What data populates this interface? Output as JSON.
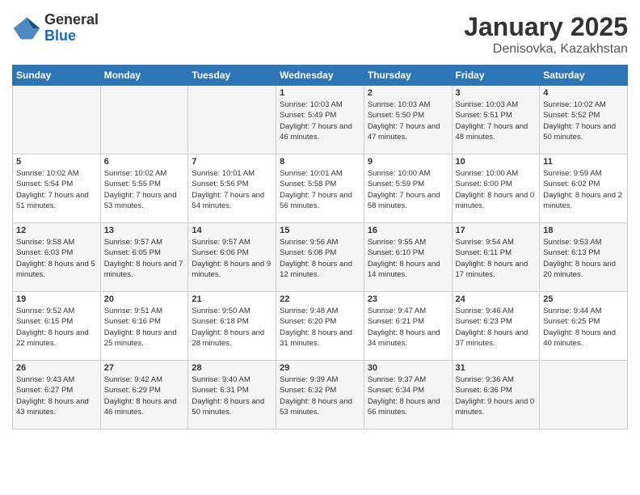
{
  "header": {
    "logo_general": "General",
    "logo_blue": "Blue",
    "title": "January 2025",
    "subtitle": "Denisovka, Kazakhstan"
  },
  "weekdays": [
    "Sunday",
    "Monday",
    "Tuesday",
    "Wednesday",
    "Thursday",
    "Friday",
    "Saturday"
  ],
  "weeks": [
    [
      {
        "day": "",
        "info": ""
      },
      {
        "day": "",
        "info": ""
      },
      {
        "day": "",
        "info": ""
      },
      {
        "day": "1",
        "info": "Sunrise: 10:03 AM\nSunset: 5:49 PM\nDaylight: 7 hours and 46 minutes."
      },
      {
        "day": "2",
        "info": "Sunrise: 10:03 AM\nSunset: 5:50 PM\nDaylight: 7 hours and 47 minutes."
      },
      {
        "day": "3",
        "info": "Sunrise: 10:03 AM\nSunset: 5:51 PM\nDaylight: 7 hours and 48 minutes."
      },
      {
        "day": "4",
        "info": "Sunrise: 10:02 AM\nSunset: 5:52 PM\nDaylight: 7 hours and 50 minutes."
      }
    ],
    [
      {
        "day": "5",
        "info": "Sunrise: 10:02 AM\nSunset: 5:54 PM\nDaylight: 7 hours and 51 minutes."
      },
      {
        "day": "6",
        "info": "Sunrise: 10:02 AM\nSunset: 5:55 PM\nDaylight: 7 hours and 53 minutes."
      },
      {
        "day": "7",
        "info": "Sunrise: 10:01 AM\nSunset: 5:56 PM\nDaylight: 7 hours and 54 minutes."
      },
      {
        "day": "8",
        "info": "Sunrise: 10:01 AM\nSunset: 5:58 PM\nDaylight: 7 hours and 56 minutes."
      },
      {
        "day": "9",
        "info": "Sunrise: 10:00 AM\nSunset: 5:59 PM\nDaylight: 7 hours and 58 minutes."
      },
      {
        "day": "10",
        "info": "Sunrise: 10:00 AM\nSunset: 6:00 PM\nDaylight: 8 hours and 0 minutes."
      },
      {
        "day": "11",
        "info": "Sunrise: 9:59 AM\nSunset: 6:02 PM\nDaylight: 8 hours and 2 minutes."
      }
    ],
    [
      {
        "day": "12",
        "info": "Sunrise: 9:58 AM\nSunset: 6:03 PM\nDaylight: 8 hours and 5 minutes."
      },
      {
        "day": "13",
        "info": "Sunrise: 9:57 AM\nSunset: 6:05 PM\nDaylight: 8 hours and 7 minutes."
      },
      {
        "day": "14",
        "info": "Sunrise: 9:57 AM\nSunset: 6:06 PM\nDaylight: 8 hours and 9 minutes."
      },
      {
        "day": "15",
        "info": "Sunrise: 9:56 AM\nSunset: 6:08 PM\nDaylight: 8 hours and 12 minutes."
      },
      {
        "day": "16",
        "info": "Sunrise: 9:55 AM\nSunset: 6:10 PM\nDaylight: 8 hours and 14 minutes."
      },
      {
        "day": "17",
        "info": "Sunrise: 9:54 AM\nSunset: 6:11 PM\nDaylight: 8 hours and 17 minutes."
      },
      {
        "day": "18",
        "info": "Sunrise: 9:53 AM\nSunset: 6:13 PM\nDaylight: 8 hours and 20 minutes."
      }
    ],
    [
      {
        "day": "19",
        "info": "Sunrise: 9:52 AM\nSunset: 6:15 PM\nDaylight: 8 hours and 22 minutes."
      },
      {
        "day": "20",
        "info": "Sunrise: 9:51 AM\nSunset: 6:16 PM\nDaylight: 8 hours and 25 minutes."
      },
      {
        "day": "21",
        "info": "Sunrise: 9:50 AM\nSunset: 6:18 PM\nDaylight: 8 hours and 28 minutes."
      },
      {
        "day": "22",
        "info": "Sunrise: 9:48 AM\nSunset: 6:20 PM\nDaylight: 8 hours and 31 minutes."
      },
      {
        "day": "23",
        "info": "Sunrise: 9:47 AM\nSunset: 6:21 PM\nDaylight: 8 hours and 34 minutes."
      },
      {
        "day": "24",
        "info": "Sunrise: 9:46 AM\nSunset: 6:23 PM\nDaylight: 8 hours and 37 minutes."
      },
      {
        "day": "25",
        "info": "Sunrise: 9:44 AM\nSunset: 6:25 PM\nDaylight: 8 hours and 40 minutes."
      }
    ],
    [
      {
        "day": "26",
        "info": "Sunrise: 9:43 AM\nSunset: 6:27 PM\nDaylight: 8 hours and 43 minutes."
      },
      {
        "day": "27",
        "info": "Sunrise: 9:42 AM\nSunset: 6:29 PM\nDaylight: 8 hours and 46 minutes."
      },
      {
        "day": "28",
        "info": "Sunrise: 9:40 AM\nSunset: 6:31 PM\nDaylight: 8 hours and 50 minutes."
      },
      {
        "day": "29",
        "info": "Sunrise: 9:39 AM\nSunset: 6:32 PM\nDaylight: 8 hours and 53 minutes."
      },
      {
        "day": "30",
        "info": "Sunrise: 9:37 AM\nSunset: 6:34 PM\nDaylight: 8 hours and 56 minutes."
      },
      {
        "day": "31",
        "info": "Sunrise: 9:36 AM\nSunset: 6:36 PM\nDaylight: 9 hours and 0 minutes."
      },
      {
        "day": "",
        "info": ""
      }
    ]
  ]
}
